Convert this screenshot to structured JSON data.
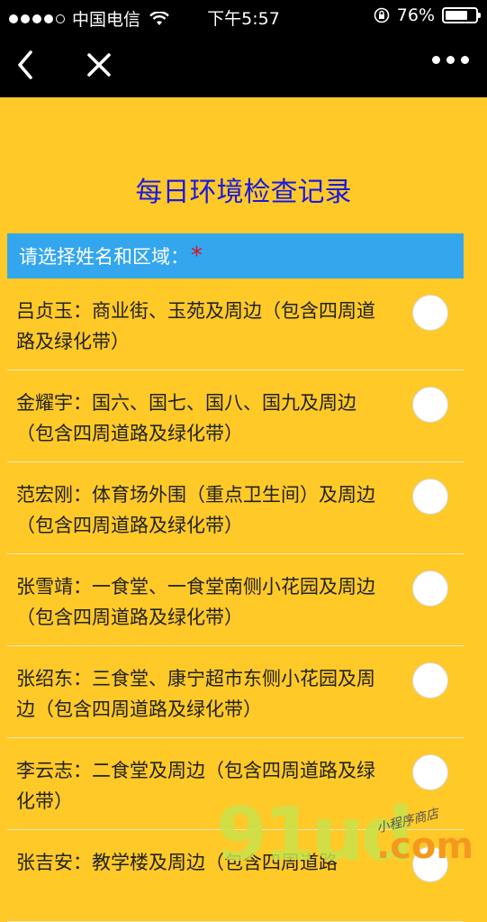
{
  "status_bar": {
    "carrier": "中国电信",
    "time": "下午5:57",
    "battery": "76%",
    "battery_level": 0.76
  },
  "nav": {
    "back_icon": "chevron-left-icon",
    "close_icon": "close-icon",
    "more_icon": "more-dots-icon"
  },
  "form": {
    "title": "每日环境检查记录",
    "question_label": "请选择姓名和区域：",
    "required_mark": "*",
    "options": [
      {
        "label": "吕贞玉：商业街、玉苑及周边（包含四周道路及绿化带）",
        "selected": false
      },
      {
        "label": "金耀宇：国六、国七、国八、国九及周边（包含四周道路及绿化带）",
        "selected": false
      },
      {
        "label": "范宏刚：体育场外围（重点卫生间）及周边（包含四周道路及绿化带）",
        "selected": false
      },
      {
        "label": "张雪靖：一食堂、一食堂南侧小花园及周边（包含四周道路及绿化带）",
        "selected": false
      },
      {
        "label": "张绍东：三食堂、康宁超市东侧小花园及周边（包含四周道路及绿化带）",
        "selected": false
      },
      {
        "label": "李云志：二食堂及周边（包含四周道路及绿化带）",
        "selected": false
      },
      {
        "label": "张吉安：教学楼及周边（包含四周道路",
        "selected": false
      }
    ]
  },
  "watermark": {
    "main": "91ud",
    "sub": "小程序商店",
    "suffix": ".com"
  }
}
